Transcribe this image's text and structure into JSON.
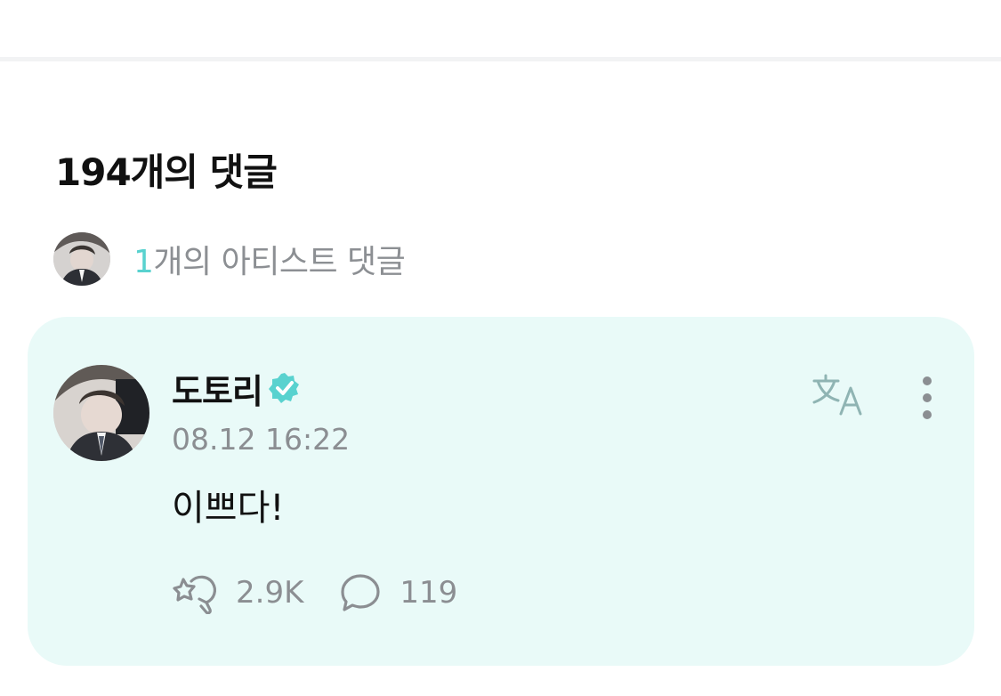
{
  "comments_section": {
    "count_label": "194개의 댓글"
  },
  "artist_summary": {
    "count": "1",
    "label": "개의 아티스트 댓글"
  },
  "comment": {
    "author": "도토리",
    "verified_icon": "verified-check-icon",
    "timestamp": "08.12 16:22",
    "text": "이쁘다!",
    "translate_icon": "translate-icon",
    "more_icon": "more-vertical-icon",
    "like_icon": "like-icon",
    "likes": "2.9K",
    "reply_icon": "reply-icon",
    "replies": "119"
  },
  "colors": {
    "accent": "#59d2cf",
    "card_background": "#e9faf8",
    "muted_text": "#8b8e92"
  }
}
